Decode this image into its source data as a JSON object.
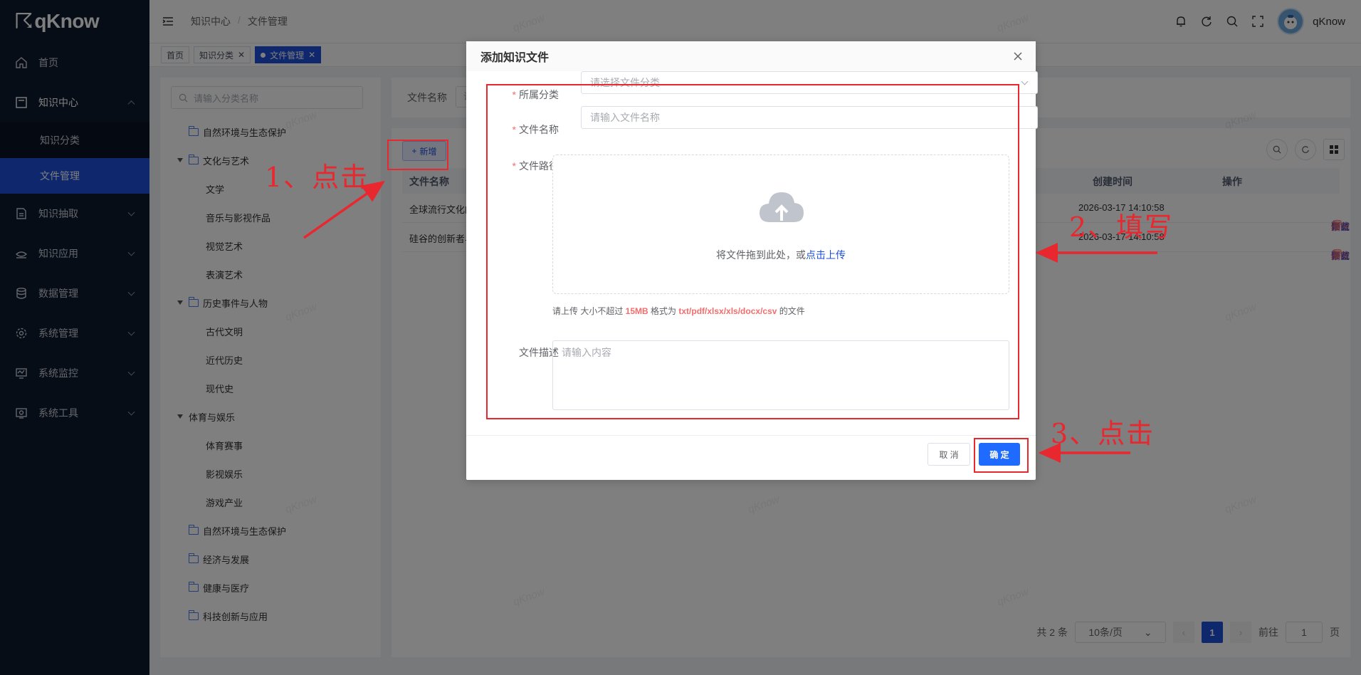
{
  "app": {
    "name": "qKnow"
  },
  "sidebar": {
    "items": [
      {
        "label": "首页",
        "icon": "home-icon"
      },
      {
        "label": "知识中心",
        "icon": "book-icon",
        "open": true,
        "children": [
          {
            "label": "知识分类"
          },
          {
            "label": "文件管理",
            "active": true
          }
        ]
      },
      {
        "label": "知识抽取",
        "icon": "extract-icon"
      },
      {
        "label": "知识应用",
        "icon": "apply-icon"
      },
      {
        "label": "数据管理",
        "icon": "database-icon"
      },
      {
        "label": "系统管理",
        "icon": "gear-icon"
      },
      {
        "label": "系统监控",
        "icon": "monitor-icon"
      },
      {
        "label": "系统工具",
        "icon": "tool-icon"
      }
    ]
  },
  "header": {
    "breadcrumb": [
      "知识中心",
      "/",
      "文件管理"
    ],
    "username": "qKnow"
  },
  "tags": [
    "首页",
    "知识分类",
    "文件管理"
  ],
  "tree": {
    "search_placeholder": "请输入分类名称",
    "nodes": [
      {
        "label": "自然环境与生态保护",
        "level": 0,
        "folder": true
      },
      {
        "label": "文化与艺术",
        "level": 0,
        "folder": true,
        "expanded": true
      },
      {
        "label": "文学",
        "level": 1
      },
      {
        "label": "音乐与影视作品",
        "level": 1
      },
      {
        "label": "视觉艺术",
        "level": 1
      },
      {
        "label": "表演艺术",
        "level": 1
      },
      {
        "label": "历史事件与人物",
        "level": 0,
        "folder": true,
        "expanded": true
      },
      {
        "label": "古代文明",
        "level": 1
      },
      {
        "label": "近代历史",
        "level": 1
      },
      {
        "label": "现代史",
        "level": 1
      },
      {
        "label": "体育与娱乐",
        "level": 0,
        "folder": false,
        "expanded": true
      },
      {
        "label": "体育赛事",
        "level": 1
      },
      {
        "label": "影视娱乐",
        "level": 1
      },
      {
        "label": "游戏产业",
        "level": 1
      },
      {
        "label": "自然环境与生态保护",
        "level": 0,
        "folder": true
      },
      {
        "label": "经济与发展",
        "level": 0,
        "folder": true
      },
      {
        "label": "健康与医疗",
        "level": 0,
        "folder": true
      },
      {
        "label": "科技创新与应用",
        "level": 0,
        "folder": true
      }
    ]
  },
  "search": {
    "label": "文件名称",
    "placeholder": "请"
  },
  "toolbar": {
    "add_label": "新增"
  },
  "table": {
    "columns": {
      "name": "文件名称",
      "created": "创建时间",
      "ops": "操作"
    },
    "rows": [
      {
        "name": "全球流行文化的",
        "created": "2026-03-17 14:10:58"
      },
      {
        "name": "硅谷的创新者与",
        "created": "2026-03-17 14:10:58"
      }
    ],
    "ops": {
      "edit": "修改",
      "preview": "预览",
      "download": "下载",
      "delete": "删除"
    }
  },
  "pager": {
    "total": "共 2 条",
    "page_size": "10条/页",
    "current": "1",
    "goto": "前往",
    "goto_value": "1",
    "page_unit": "页"
  },
  "watermark": "qKnow",
  "dialog": {
    "title": "添加知识文件",
    "fields": {
      "category": {
        "label": "所属分类",
        "placeholder": "请选择文件分类",
        "required": true
      },
      "name": {
        "label": "文件名称",
        "placeholder": "请输入文件名称",
        "required": true
      },
      "path": {
        "label": "文件路径",
        "required": true,
        "drop_text": "将文件拖到此处，或",
        "upload_link": "点击上传",
        "tip_prefix": "请上传 大小不超过 ",
        "size": "15MB",
        "tip_mid": " 格式为 ",
        "formats": "txt/pdf/xlsx/xls/docx/csv",
        "tip_suffix": " 的文件"
      },
      "desc": {
        "label": "文件描述",
        "placeholder": "请输入内容"
      }
    },
    "cancel_label": "取 消",
    "ok_label": "确 定"
  },
  "annotations": {
    "step1": "1、点击",
    "step2": "2、填写",
    "step3": "3、点击",
    "color": "#e8272e"
  },
  "colors": {
    "primary": "#1f4fd8",
    "sidebar_bg": "#0f1a2e",
    "danger": "#f56c6c"
  }
}
